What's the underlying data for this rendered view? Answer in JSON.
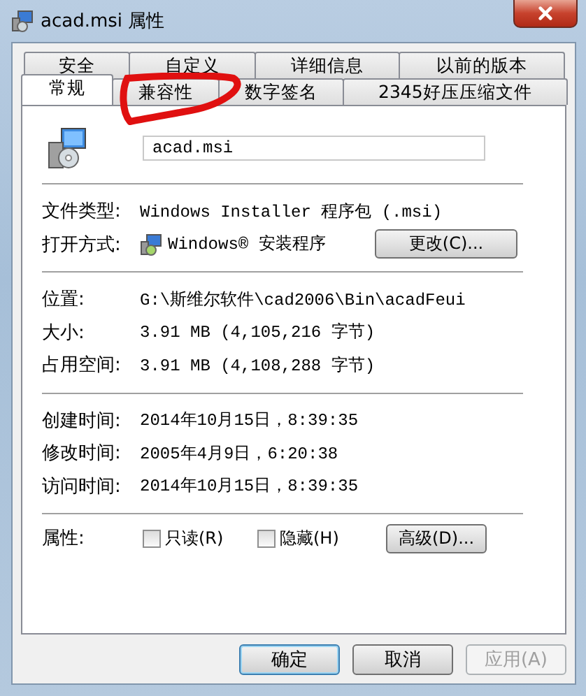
{
  "window": {
    "title": "acad.msi 属性"
  },
  "tab_rows": [
    {
      "tabs": [
        {
          "label": "安全",
          "selected": false
        },
        {
          "label": "自定义",
          "selected": false
        },
        {
          "label": "详细信息",
          "selected": false
        },
        {
          "label": "以前的版本",
          "selected": false
        }
      ]
    },
    {
      "tabs": [
        {
          "label": "常规",
          "selected": true
        },
        {
          "label": "兼容性",
          "selected": false
        },
        {
          "label": "数字签名",
          "selected": false
        },
        {
          "label": "2345好压压缩文件",
          "selected": false
        }
      ]
    }
  ],
  "annotations": [
    {
      "kind": "freehand_circle"
    }
  ],
  "file_name": {
    "value": "acad.msi"
  },
  "sections": [
    {
      "rows": [
        {
          "kind": "text",
          "label": "文件类型:",
          "value": "Windows Installer 程序包 (.msi)"
        },
        {
          "kind": "app",
          "label": "打开方式:",
          "value": "Windows® 安装程序",
          "button": "更改(C)..."
        }
      ]
    },
    {
      "rows": [
        {
          "kind": "text",
          "label": "位置:",
          "value": "G:\\斯维尔软件\\cad2006\\Bin\\acadFeui"
        },
        {
          "kind": "text",
          "label": "大小:",
          "value": "3.91 MB (4,105,216 字节)"
        },
        {
          "kind": "text",
          "label": "占用空间:",
          "value": "3.91 MB (4,108,288 字节)"
        }
      ]
    },
    {
      "rows": [
        {
          "kind": "text",
          "label": "创建时间:",
          "value": "2014年10月15日，8:39:35"
        },
        {
          "kind": "text",
          "label": "修改时间:",
          "value": "2005年4月9日，6:20:38"
        },
        {
          "kind": "text",
          "label": "访问时间:",
          "value": "2014年10月15日，8:39:35"
        }
      ]
    }
  ],
  "attributes": {
    "label": "属性:",
    "checkboxes": [
      {
        "label": "只读(R)",
        "checked": false
      },
      {
        "label": "隐藏(H)",
        "checked": false
      }
    ],
    "button": "高级(D)..."
  },
  "buttons": [
    {
      "label": "确定",
      "default": true,
      "disabled": false
    },
    {
      "label": "取消",
      "default": false,
      "disabled": false
    },
    {
      "label": "应用(A)",
      "default": false,
      "disabled": true
    }
  ]
}
